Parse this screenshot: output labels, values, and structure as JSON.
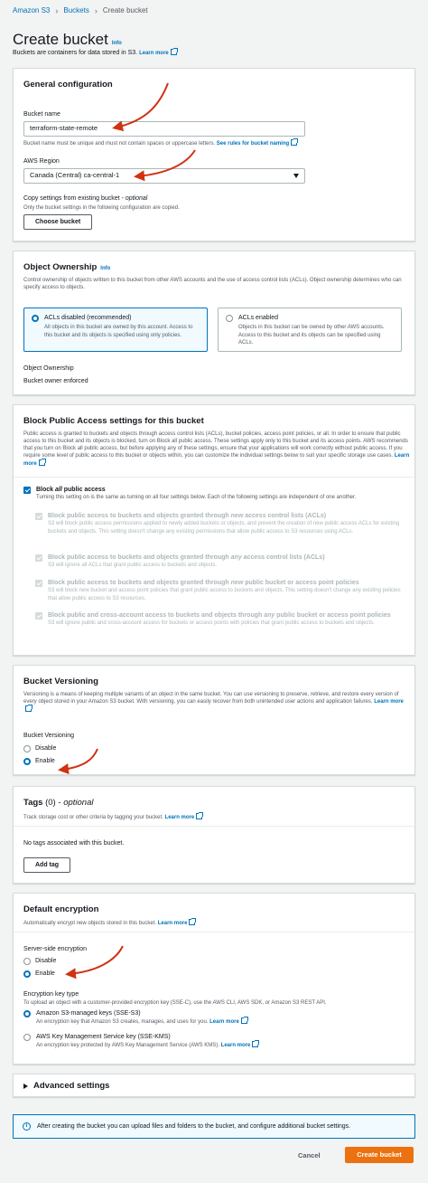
{
  "breadcrumb": {
    "root": "Amazon S3",
    "buckets": "Buckets",
    "current": "Create bucket"
  },
  "header": {
    "title": "Create bucket",
    "info": "Info",
    "subtitle": "Buckets are containers for data stored in S3.",
    "learn_more": "Learn more"
  },
  "general": {
    "title": "General configuration",
    "bucket_name_label": "Bucket name",
    "bucket_name_value": "terraform-state-remote",
    "bucket_name_hint": "Bucket name must be unique and must not contain spaces or uppercase letters.",
    "bucket_name_link": "See rules for bucket naming",
    "region_label": "AWS Region",
    "region_value": "Canada (Central) ca-central-1",
    "copy_label_prefix": "Copy settings from existing bucket - ",
    "copy_label_optional": "optional",
    "copy_hint": "Only the bucket settings in the following configuration are copied.",
    "choose_bucket": "Choose bucket"
  },
  "ownership": {
    "title": "Object Ownership",
    "info": "Info",
    "desc": "Control ownership of objects written to this bucket from other AWS accounts and the use of access control lists (ACLs). Object ownership determines who can specify access to objects.",
    "option1_title": "ACLs disabled (recommended)",
    "option1_desc": "All objects in this bucket are owned by this account. Access to this bucket and its objects is specified using only policies.",
    "option2_title": "ACLs enabled",
    "option2_desc": "Objects in this bucket can be owned by other AWS accounts. Access to this bucket and its objects can be specified using ACLs.",
    "field_label": "Object Ownership",
    "field_value": "Bucket owner enforced"
  },
  "block": {
    "title": "Block Public Access settings for this bucket",
    "desc": "Public access is granted to buckets and objects through access control lists (ACLs), bucket policies, access point policies, or all. In order to ensure that public access to this bucket and its objects is blocked, turn on Block all public access. These settings apply only to this bucket and its access points. AWS recommends that you turn on Block all public access, but before applying any of these settings, ensure that your applications will work correctly without public access. If you require some level of public access to this bucket or objects within, you can customize the individual settings below to suit your specific storage use cases.",
    "learn_more": "Learn more",
    "all_prefix": "Block ",
    "all_em": "all",
    "all_suffix": " public access",
    "all_desc": "Turning this setting on is the same as turning on all four settings below. Each of the following settings are independent of one another.",
    "s1_a": "Block public access to buckets and objects granted through ",
    "s1_em": "new",
    "s1_b": " access control lists (ACLs)",
    "s1_desc": "S3 will block public access permissions applied to newly added buckets or objects, and prevent the creation of new public access ACLs for existing buckets and objects. This setting doesn't change any existing permissions that allow public access to S3 resources using ACLs.",
    "s2_a": "Block public access to buckets and objects granted through ",
    "s2_em": "any",
    "s2_b": " access control lists (ACLs)",
    "s2_desc": "S3 will ignore all ACLs that grant public access to buckets and objects.",
    "s3_a": "Block public access to buckets and objects granted through ",
    "s3_em": "new",
    "s3_b": " public bucket or access point policies",
    "s3_desc": "S3 will block new bucket and access point policies that grant public access to buckets and objects. This setting doesn't change any existing policies that allow public access to S3 resources.",
    "s4_a": "Block public and cross-account access to buckets and objects through ",
    "s4_em": "any",
    "s4_b": " public bucket or access point policies",
    "s4_desc": "S3 will ignore public and cross-account access for buckets or access points with policies that grant public access to buckets and objects."
  },
  "versioning": {
    "title": "Bucket Versioning",
    "desc": "Versioning is a means of keeping multiple variants of an object in the same bucket. You can use versioning to preserve, retrieve, and restore every version of every object stored in your Amazon S3 bucket. With versioning, you can easily recover from both unintended user actions and application failures.",
    "learn_more": "Learn more",
    "field_label": "Bucket Versioning",
    "disable": "Disable",
    "enable": "Enable"
  },
  "tags": {
    "title": "Tags",
    "count": "(0)",
    "optional": "optional",
    "desc": "Track storage cost or other criteria by tagging your bucket.",
    "learn_more": "Learn more",
    "empty": "No tags associated with this bucket.",
    "add_tag": "Add tag"
  },
  "encryption": {
    "title": "Default encryption",
    "desc": "Automatically encrypt new objects stored in this bucket.",
    "learn_more": "Learn more",
    "sse_label": "Server-side encryption",
    "disable": "Disable",
    "enable": "Enable",
    "key_type_label": "Encryption key type",
    "key_type_desc": "To upload an object with a customer-provided encryption key (SSE-C), use the AWS CLI, AWS SDK, or Amazon S3 REST API.",
    "opt1_title": "Amazon S3-managed keys (SSE-S3)",
    "opt1_desc": "An encryption key that Amazon S3 creates, manages, and uses for you.",
    "opt1_link": "Learn more",
    "opt2_title": "AWS Key Management Service key (SSE-KMS)",
    "opt2_desc": "An encryption key protected by AWS Key Management Service (AWS KMS).",
    "opt2_link": "Learn more"
  },
  "advanced": {
    "title": "Advanced settings"
  },
  "footer": {
    "info": "After creating the bucket you can upload files and folders to the bucket, and configure additional bucket settings.",
    "cancel": "Cancel",
    "create": "Create bucket"
  },
  "colors": {
    "accent": "#0073bb",
    "primary_button": "#ec7211",
    "annotation_arrow": "#d13212"
  }
}
